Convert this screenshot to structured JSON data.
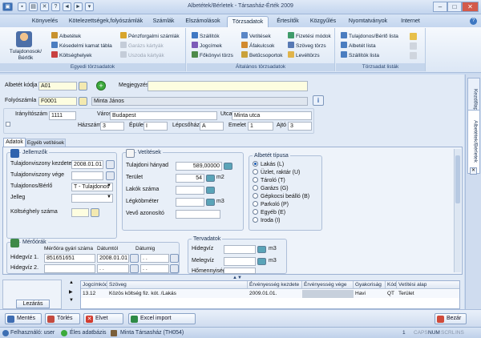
{
  "window": {
    "title": "Albetétek/Bérletek - Társasház-Érték 2009",
    "min": "–",
    "max": "□",
    "close": "✕"
  },
  "menu_tabs": [
    "Könyvelés",
    "Kötelezettségek,folyószámlák",
    "Számlák",
    "Elszámolások",
    "Törzsadatok",
    "Értesítők",
    "Közgyűlés",
    "Nyomtatványok",
    "Internet"
  ],
  "ribbon": {
    "group1": {
      "label": "Egyedi törzsadatok",
      "big_item": "Tulajdonosok/ Bérlők",
      "items": [
        "Albetétek",
        "Késedelmi kamat tábla",
        "Költséghelyek",
        "Pénzforgalmi számlák",
        "Garázs kártyák",
        "Uszoda kártyák"
      ]
    },
    "group2": {
      "label": "Általános törzsadatok",
      "items": [
        "Szállítók",
        "Jogcímek",
        "Főkönyvi törzs",
        "Vetítések",
        "Áfakulcsok",
        "Betűcsoportok",
        "Fizetési módok",
        "Szöveg törzs",
        "Levéltörzs"
      ]
    },
    "group3": {
      "label": "Törzsadat listák",
      "items": [
        "Tulajdonos/Bérlő lista",
        "Albetét lista",
        "Szállítók lista"
      ]
    }
  },
  "side_tabs": [
    "Kezdőlap",
    "Albetétek/Bérletek"
  ],
  "form": {
    "albetet_kodja_label": "Albetét kódja",
    "albetet_kodja": "A01",
    "megjegyzes_label": "Megjegyzés",
    "folyoszamla_label": "Folyószámla",
    "folyoszamla": "F0001",
    "folyoszamla_name": "Minta János",
    "iranyitoszam_label": "Irányítószám",
    "iranyitoszam": "1111",
    "varos_label": "Város",
    "varos": "Budapest",
    "utca_label": "Utca",
    "utca": "Minta utca",
    "hazszam_label": "Házszám",
    "hazszam": "3",
    "epulet_label": "Épület",
    "epulet": "I",
    "lepcsohaz_label": "Lépcsőház",
    "lepcsohaz": "A",
    "emelet_label": "Emelet",
    "emelet": "1",
    "ajto_label": "Ajtó",
    "ajto": "3"
  },
  "tabs": [
    "Adatok",
    "Egyéb vetítések"
  ],
  "jellemzok": {
    "title": "Jellemzők",
    "kezdete_label": "Tulajdonviszony kezdete",
    "kezdete": "2008.01.01",
    "vege_label": "Tulajdonviszony vége",
    "vege": "",
    "tulajdonos_label": "Tulajdonos/Bérlő",
    "tulajdonos": "T - Tulajdonos",
    "jelleg_label": "Jelleg",
    "koltseghely_label": "Költséghely száma"
  },
  "vetitesek": {
    "title": "Vetítések",
    "hanyad_label": "Tulajdoni hányad",
    "hanyad": "589,00000",
    "terulet_label": "Terület",
    "terulet": "54",
    "terulet_unit": "m2",
    "lakok_label": "Lakók száma",
    "legkobmeter_label": "Légköbméter",
    "legkobmeter_unit": "m3",
    "vevo_label": "Vevő azonosító"
  },
  "albetet_tipusa": {
    "title": "Albetét típusa",
    "options": [
      "Lakás (L)",
      "Üzlet, raktár (U)",
      "Tároló (T)",
      "Garázs (G)",
      "Gépkocsi beálló (B)",
      "Parkoló (P)",
      "Egyéb (E)",
      "Iroda (I)"
    ],
    "selected": "Lakás (L)"
  },
  "merorak": {
    "title": "Mérőórák",
    "col_gyari": "Mérőóra gyári száma",
    "col_datumtol": "Dátumtól",
    "col_datumig": "Dátumig",
    "row1_label": "Hidegvíz 1.",
    "row1_gyari": "851651651",
    "row1_datumtol": "2008.01.01",
    "row1_datumig": ". .",
    "row2_label": "Hidegvíz 2.",
    "row2_gyari": "",
    "row2_datumtol": ". .",
    "row2_datumig": ". ."
  },
  "tervadatok": {
    "title": "Tervadatok",
    "hidegviz_label": "Hidegvíz",
    "melegviz_label": "Melegvíz",
    "homennyiseg_label": "Hőmennyiség",
    "unit": "m3"
  },
  "lezaras": "Lezárás",
  "table": {
    "headers": [
      "Jogcímkód",
      "Szöveg",
      "Érvényesség kezdete",
      "Érvényesség vége",
      "Gyakoriság",
      "Kód",
      "Vetítési alap"
    ],
    "rows": [
      [
        "13.12",
        "Közös költség fiz. kót. /Lakás",
        "2009.01.01.",
        "",
        "Havi",
        "QT",
        "Terület"
      ]
    ]
  },
  "buttons": {
    "mentes": "Mentés",
    "torles": "Törlés",
    "elvet": "Elvet",
    "excel": "Excel import",
    "bezar": "Bezár"
  },
  "status": {
    "user": "Felhasználó: user",
    "db": "Éles adatbázis",
    "company": "Minta Társasház (TH054)",
    "indicators": [
      "1",
      "CAPS",
      "NUM",
      "SCRL",
      "INS"
    ]
  }
}
